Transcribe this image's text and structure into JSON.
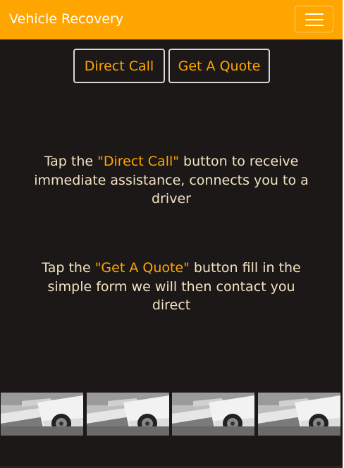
{
  "navbar": {
    "brand": "Vehicle Recovery",
    "toggler_icon": "hamburger-menu-icon",
    "background_color": "#ffa500"
  },
  "buttons": {
    "direct_call": "Direct Call",
    "get_quote": "Get A Quote"
  },
  "instructions": [
    {
      "prefix": "Tap the ",
      "highlight": "\"Direct Call\"",
      "suffix": " button to receive immediate assistance, connects you to a driver"
    },
    {
      "prefix": "Tap the ",
      "highlight": "\"Get A Quote\"",
      "suffix": " button fill in the simple form we will then contact you direct"
    }
  ],
  "gallery": {
    "image_subject": "tow-truck-car-photo",
    "count": 4
  },
  "colors": {
    "accent": "#ffa500",
    "page_background": "#1c1817",
    "body_text": "#f3e3c4"
  }
}
